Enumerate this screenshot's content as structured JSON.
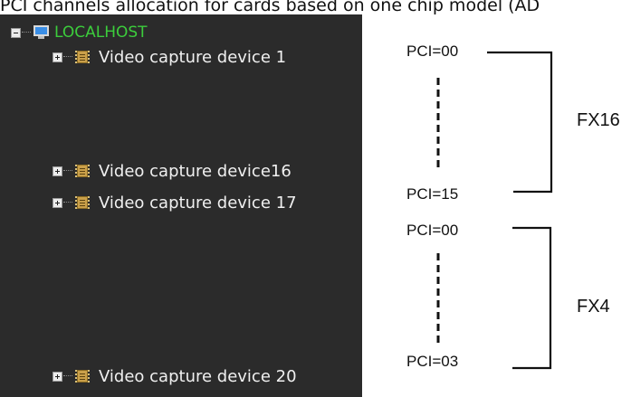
{
  "caption": "PCI channels allocation for cards based on one chip model (AD",
  "tree": {
    "host": {
      "label": "LOCALHOST",
      "color": "#3ccd3c",
      "icon": "monitor-icon"
    },
    "devices": [
      {
        "label": "Video capture device 1",
        "icon": "chip-icon"
      },
      {
        "label": "Video capture device16",
        "icon": "chip-icon"
      },
      {
        "label": "Video capture device 17",
        "icon": "chip-icon"
      },
      {
        "label": "Video capture device 20",
        "icon": "chip-icon"
      }
    ]
  },
  "groups": [
    {
      "name": "FX16",
      "pci_start": "PCI=00",
      "pci_end": "PCI=15"
    },
    {
      "name": "FX4",
      "pci_start": "PCI=00",
      "pci_end": "PCI=03"
    }
  ]
}
